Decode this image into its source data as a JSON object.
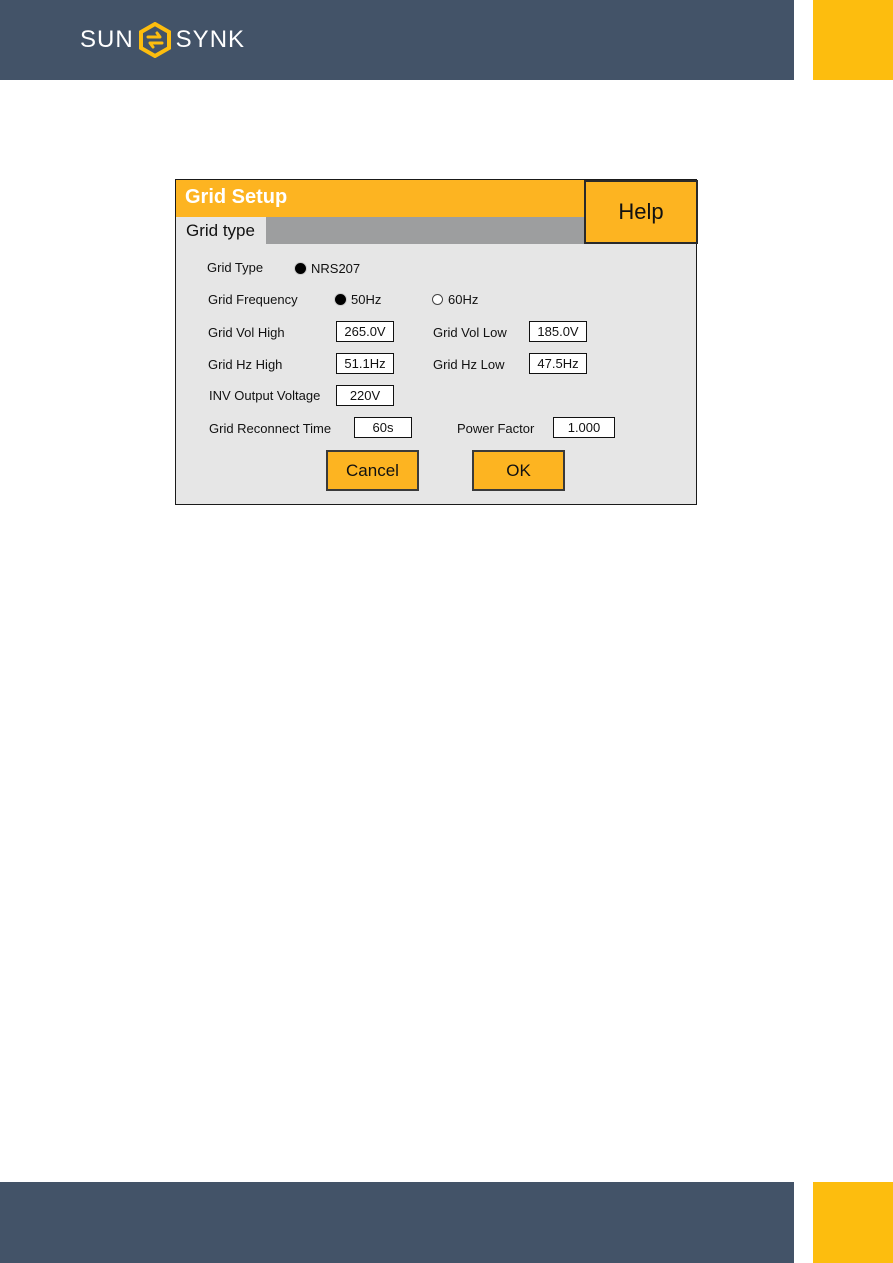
{
  "brand": {
    "name_left": "SUN",
    "name_right": "SYNK",
    "logo_icon": "hexagon-arrows-icon",
    "colors": {
      "navy": "#435368",
      "yellow": "#fdbd0e",
      "dialog_orange": "#fdb421",
      "dialog_bg": "#e6e6e6",
      "tab_gray": "#9d9e9f"
    }
  },
  "dialog": {
    "title": "Grid Setup",
    "help_label": "Help",
    "tabs": [
      {
        "label": "Grid type",
        "active": true
      }
    ],
    "grid_type": {
      "label": "Grid Type",
      "options": [
        {
          "label": "NRS207",
          "selected": true
        }
      ]
    },
    "grid_frequency": {
      "label": "Grid Frequency",
      "options": [
        {
          "label": "50Hz",
          "selected": true
        },
        {
          "label": "60Hz",
          "selected": false
        }
      ]
    },
    "fields": {
      "grid_vol_high": {
        "label": "Grid Vol High",
        "value": "265.0V"
      },
      "grid_vol_low": {
        "label": "Grid Vol Low",
        "value": "185.0V"
      },
      "grid_hz_high": {
        "label": "Grid Hz High",
        "value": "51.1Hz"
      },
      "grid_hz_low": {
        "label": "Grid Hz Low",
        "value": "47.5Hz"
      },
      "inv_output_voltage": {
        "label": "INV Output Voltage",
        "value": "220V"
      },
      "grid_reconnect_time": {
        "label": "Grid Reconnect Time",
        "value": "60s"
      },
      "power_factor": {
        "label": "Power Factor",
        "value": "1.000"
      }
    },
    "buttons": {
      "cancel": "Cancel",
      "ok": "OK"
    }
  }
}
